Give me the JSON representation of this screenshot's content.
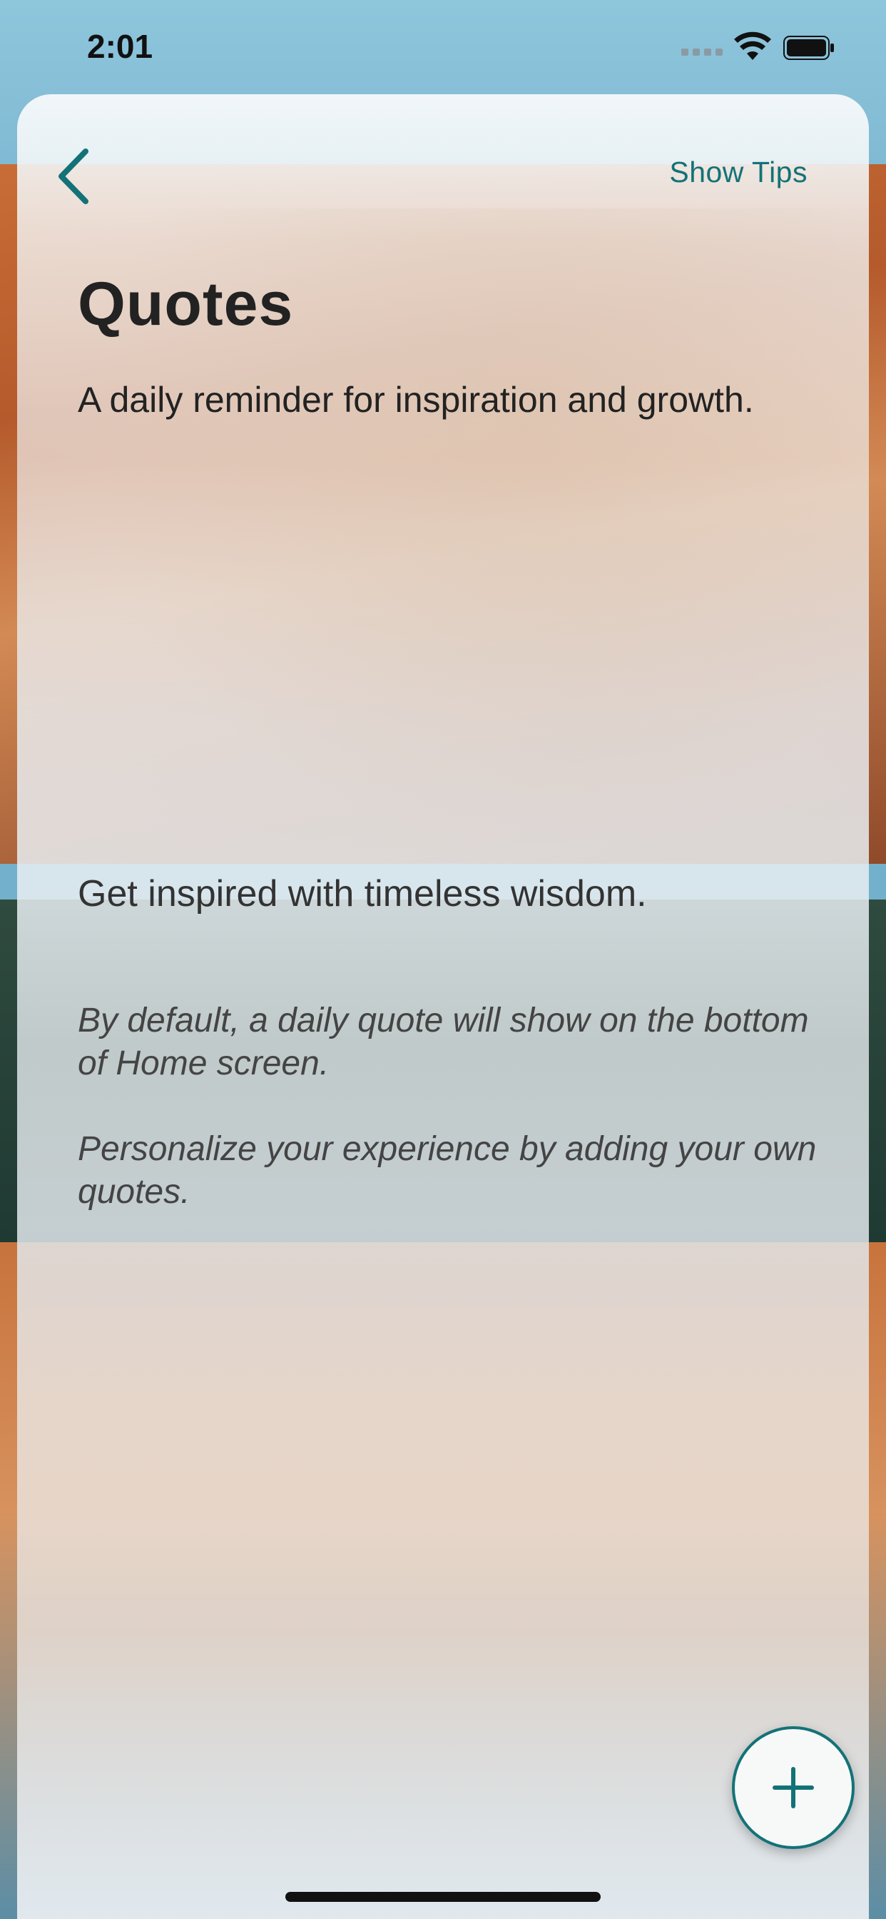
{
  "status_bar": {
    "time": "2:01"
  },
  "header": {
    "back_icon": "chevron-left-icon",
    "show_tips_label": "Show Tips"
  },
  "main": {
    "title": "Quotes",
    "subtitle": "A daily reminder for inspiration and growth.",
    "inspire_text": "Get inspired with timeless wisdom.",
    "info_default": "By default, a daily quote will show on the bottom of Home screen.",
    "info_personalize": "Personalize your experience by adding your own quotes."
  },
  "fab": {
    "icon": "plus-icon"
  },
  "colors": {
    "accent": "#137277",
    "text": "#222222"
  }
}
